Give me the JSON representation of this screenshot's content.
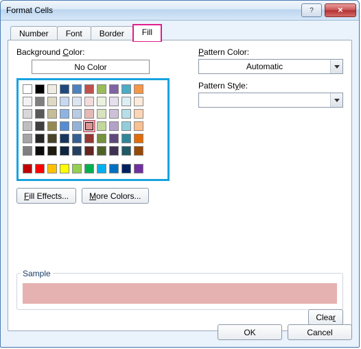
{
  "title": "Format Cells",
  "tabs": [
    {
      "label": "Number"
    },
    {
      "label": "Font"
    },
    {
      "label": "Border"
    },
    {
      "label": "Fill",
      "selected": true,
      "highlight": true
    }
  ],
  "left": {
    "bg_label_pre": "Background ",
    "bg_u": "C",
    "bg_label_post": "olor:",
    "no_color": "No Color",
    "effects_u": "F",
    "effects_post": "ill Effects...",
    "more_u": "M",
    "more_post": "ore Colors..."
  },
  "right": {
    "pc_u": "P",
    "pc_post": "attern Color:",
    "pc_val": "Automatic",
    "ps_pre": "Pattern St",
    "ps_u": "y",
    "ps_post": "le:",
    "ps_val": ""
  },
  "sample": {
    "label": "Sample",
    "color": "#e6b1b1"
  },
  "buttons": {
    "clear_pre": "Clea",
    "clear_u": "r",
    "ok": "OK",
    "cancel": "Cancel"
  },
  "palette_theme": [
    [
      "#ffffff",
      "#000000",
      "#eeece1",
      "#1f497d",
      "#4f81bd",
      "#c0504d",
      "#9bbb59",
      "#8064a2",
      "#4bacc6",
      "#f79646"
    ],
    [
      "#f2f2f2",
      "#7f7f7f",
      "#ddd9c3",
      "#c6d9f0",
      "#dbe5f1",
      "#f2dcdb",
      "#ebf1dd",
      "#e5e0ec",
      "#dbeef3",
      "#fdeada"
    ],
    [
      "#d8d8d8",
      "#595959",
      "#c4bd97",
      "#8db3e2",
      "#b8cce4",
      "#e5b9b7",
      "#d7e3bc",
      "#ccc1d9",
      "#b7dde8",
      "#fbd5b5"
    ],
    [
      "#bfbfbf",
      "#3f3f3f",
      "#938953",
      "#548dd4",
      "#95b3d7",
      "#d99694",
      "#c3d69b",
      "#b2a2c7",
      "#92cddc",
      "#fac08f"
    ],
    [
      "#a5a5a5",
      "#262626",
      "#494429",
      "#17365d",
      "#366092",
      "#953734",
      "#76923c",
      "#5f497a",
      "#31859b",
      "#e36c09"
    ],
    [
      "#7f7f7f",
      "#0c0c0c",
      "#1d1b10",
      "#0f243e",
      "#244061",
      "#632423",
      "#4f6128",
      "#3f3151",
      "#205867",
      "#974806"
    ]
  ],
  "selected_swatch": [
    3,
    5
  ],
  "palette_standard": [
    "#c00000",
    "#ff0000",
    "#ffc000",
    "#ffff00",
    "#92d050",
    "#00b050",
    "#00b0f0",
    "#0070c0",
    "#002060",
    "#7030a0"
  ]
}
